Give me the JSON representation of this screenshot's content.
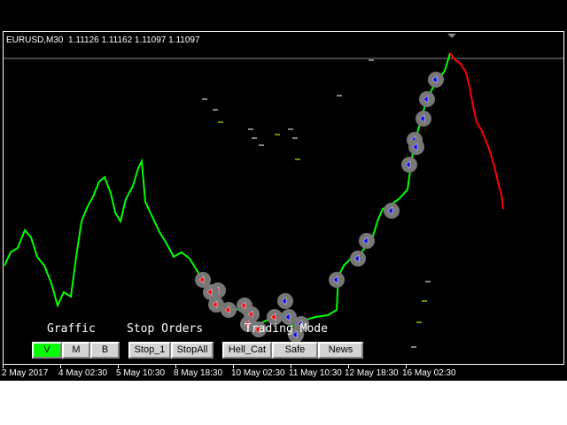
{
  "chart_header": {
    "symbol_tf": "EURUSD,M30",
    "ohlc": "1.11126 1.11162 1.11097 1.11097"
  },
  "colors": {
    "up_line": "#00ff00",
    "down_line": "#ff0000",
    "background": "#000000",
    "active_button": "#00ff00"
  },
  "panel": {
    "graffic_label": "Graffic",
    "stop_orders_label": "Stop Orders",
    "trading_mode_label": "Trading Mode",
    "graffic_buttons": [
      "V",
      "M",
      "B"
    ],
    "graffic_active": "V",
    "stop_buttons": [
      "Stop_1",
      "StopAll"
    ],
    "mode_buttons": [
      "Hell_Cat",
      "Safe",
      "News"
    ]
  },
  "time_axis": [
    "2 May 2017",
    "4 May 02:30",
    "5 May 10:30",
    "8 May 18:30",
    "10 May 02:30",
    "11 May 10:30",
    "12 May 18:30",
    "16 May 02:30"
  ]
}
